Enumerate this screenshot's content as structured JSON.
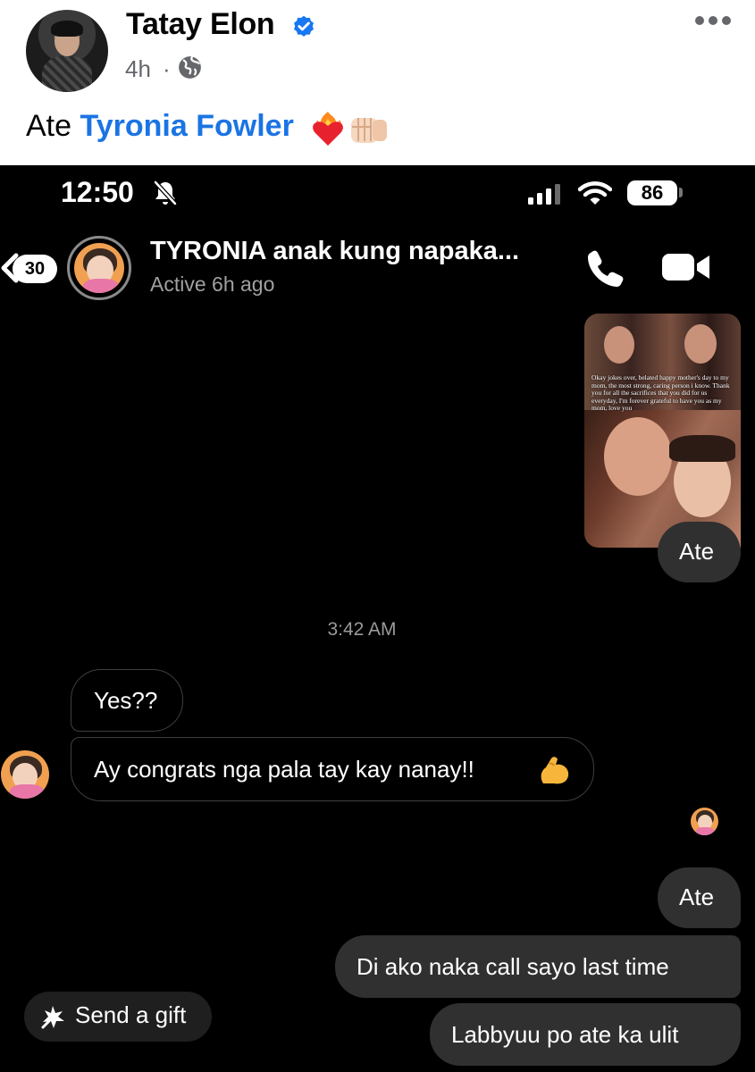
{
  "post": {
    "author": "Tatay Elon",
    "time": "4h",
    "separator": "·",
    "text_prefix": "Ate",
    "tagged_name": "Tyronia Fowler",
    "icons": [
      "verified-badge-icon",
      "globe-icon",
      "more-dots-icon",
      "heart-on-fire-emoji",
      "fist-bump-emoji"
    ],
    "colors": {
      "link": "#1b74e4",
      "meta": "#65676b",
      "verified": "#1877f2"
    }
  },
  "status_bar": {
    "time": "12:50",
    "battery": "86",
    "icons": [
      "bell-off-icon",
      "signal-icon",
      "wifi-icon",
      "battery-icon"
    ]
  },
  "chat_header": {
    "unread_count": "30",
    "title": "TYRONIA anak kung napaka...",
    "status": "Active 6h ago",
    "icons": [
      "back-chevron-icon",
      "phone-icon",
      "video-camera-icon"
    ]
  },
  "photo_caption": "Okay jokes over, belated happy mother's day to my mom, the most strong, caring person i know. Thank you for all the sacrifices that you did for us everyday, I'm forever grateful to have you as my mom, love you",
  "messages": {
    "ate_1": "Ate",
    "timestamp": "3:42 AM",
    "yes": "Yes??",
    "congrats": "Ay congrats nga pala tay kay nanay!!",
    "ate_2": "Ate",
    "di_ako": "Di ako naka call sayo last time",
    "labbyuu": "Labbyuu po ate ka ulit"
  },
  "gift": {
    "label": "Send a gift"
  },
  "theme": {
    "background": "#000000",
    "outgoing_bubble": "#303030",
    "incoming_border": "#3f3f3f"
  }
}
